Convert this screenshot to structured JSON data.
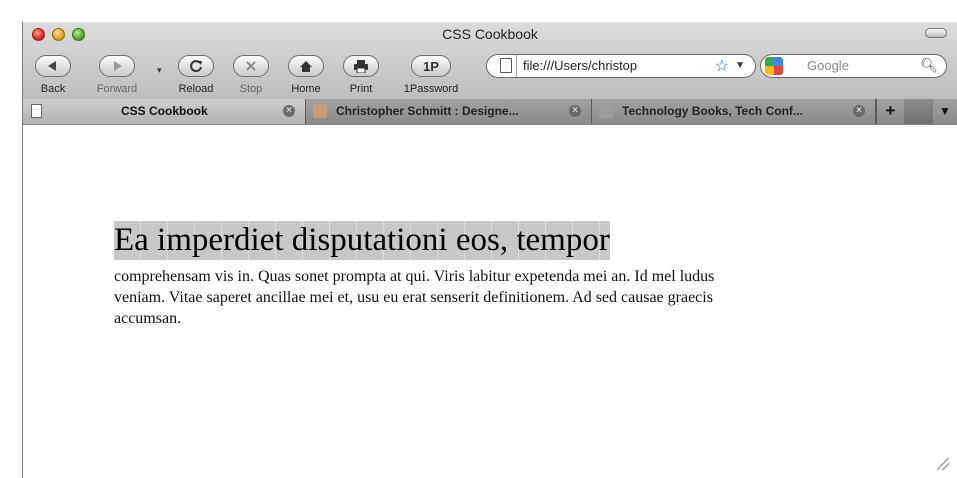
{
  "window": {
    "title": "CSS Cookbook"
  },
  "toolbar": {
    "back_label": "Back",
    "forward_label": "Forward",
    "reload_label": "Reload",
    "stop_label": "Stop",
    "home_label": "Home",
    "print_label": "Print",
    "onepassword_label": "1Password",
    "onepassword_glyph": "1P"
  },
  "address_bar": {
    "url": "file:///Users/christop"
  },
  "search_bar": {
    "placeholder": "Google"
  },
  "tabs": [
    {
      "label": "CSS Cookbook",
      "active": true
    },
    {
      "label": "Christopher Schmitt : Designe...",
      "active": false
    },
    {
      "label": "Technology Books, Tech Conf...",
      "active": false
    }
  ],
  "new_tab_glyph": "+",
  "page": {
    "heading": "Ea imperdiet disputationi eos, tempor",
    "body": "comprehensam vis in. Quas sonet prompta at qui. Viris labitur expetenda mei an. Id mel ludus veniam. Vitae saperet ancillae mei et, usu eu erat senserit definitionem. Ad sed causae graecis accumsan."
  },
  "colors": {
    "heading_highlight": "#c8c8c8",
    "traffic_red": "#d8271a",
    "traffic_yellow": "#d79a13",
    "traffic_green": "#4a9e1d"
  }
}
